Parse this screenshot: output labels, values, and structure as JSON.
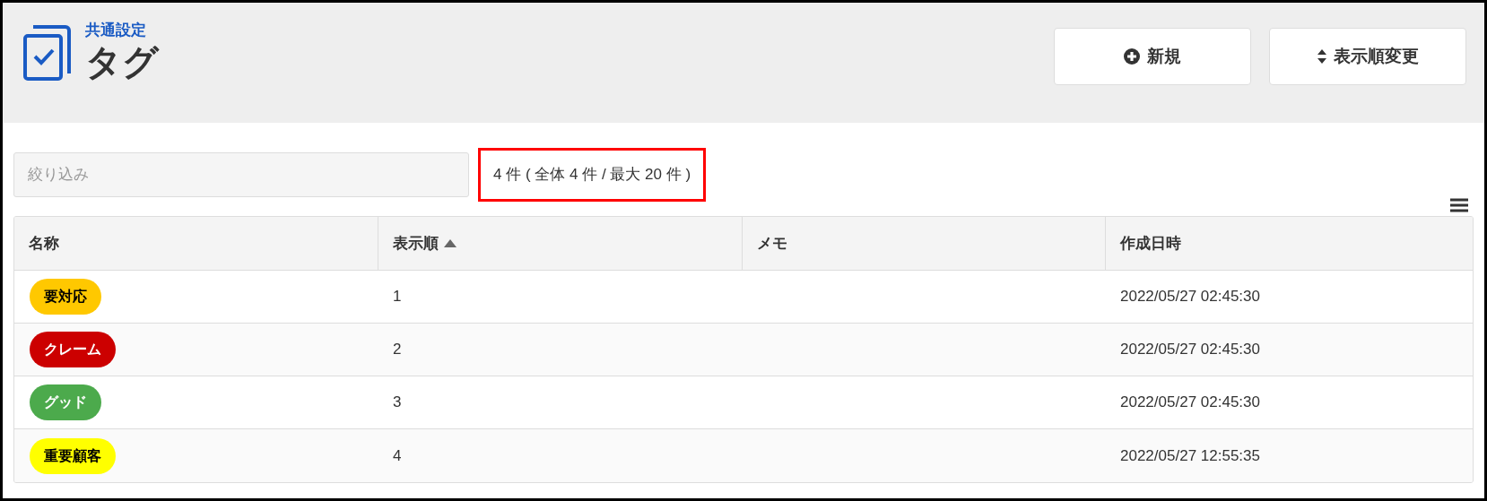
{
  "header": {
    "breadcrumb": "共通設定",
    "title": "タグ"
  },
  "buttons": [
    {
      "kind": "new",
      "label": "新規"
    },
    {
      "kind": "reorder",
      "label": "表示順変更"
    }
  ],
  "filter": {
    "placeholder": "絞り込み"
  },
  "count": {
    "text": "4 件 ( 全体 4 件 / 最大 20 件 )",
    "highlighted": true
  },
  "table": {
    "columns": [
      {
        "label": "名称",
        "sorted": false
      },
      {
        "label": "表示順",
        "sorted": true
      },
      {
        "label": "メモ",
        "sorted": false
      },
      {
        "label": "作成日時",
        "sorted": false
      }
    ],
    "rows": [
      {
        "name": "要対応",
        "color": "#ffc800",
        "order": "1",
        "created": "2022/05/27 02:45:30"
      },
      {
        "name": "クレーム",
        "color": "#cc0000",
        "order": "2",
        "created": "2022/05/27 02:45:30"
      },
      {
        "name": "グッド",
        "color": "#4caa4c",
        "order": "3",
        "created": "2022/05/27 02:45:30"
      },
      {
        "name": "重要顧客",
        "color": "#ffff00",
        "order": "4",
        "created": "2022/05/27 12:55:35"
      }
    ]
  }
}
